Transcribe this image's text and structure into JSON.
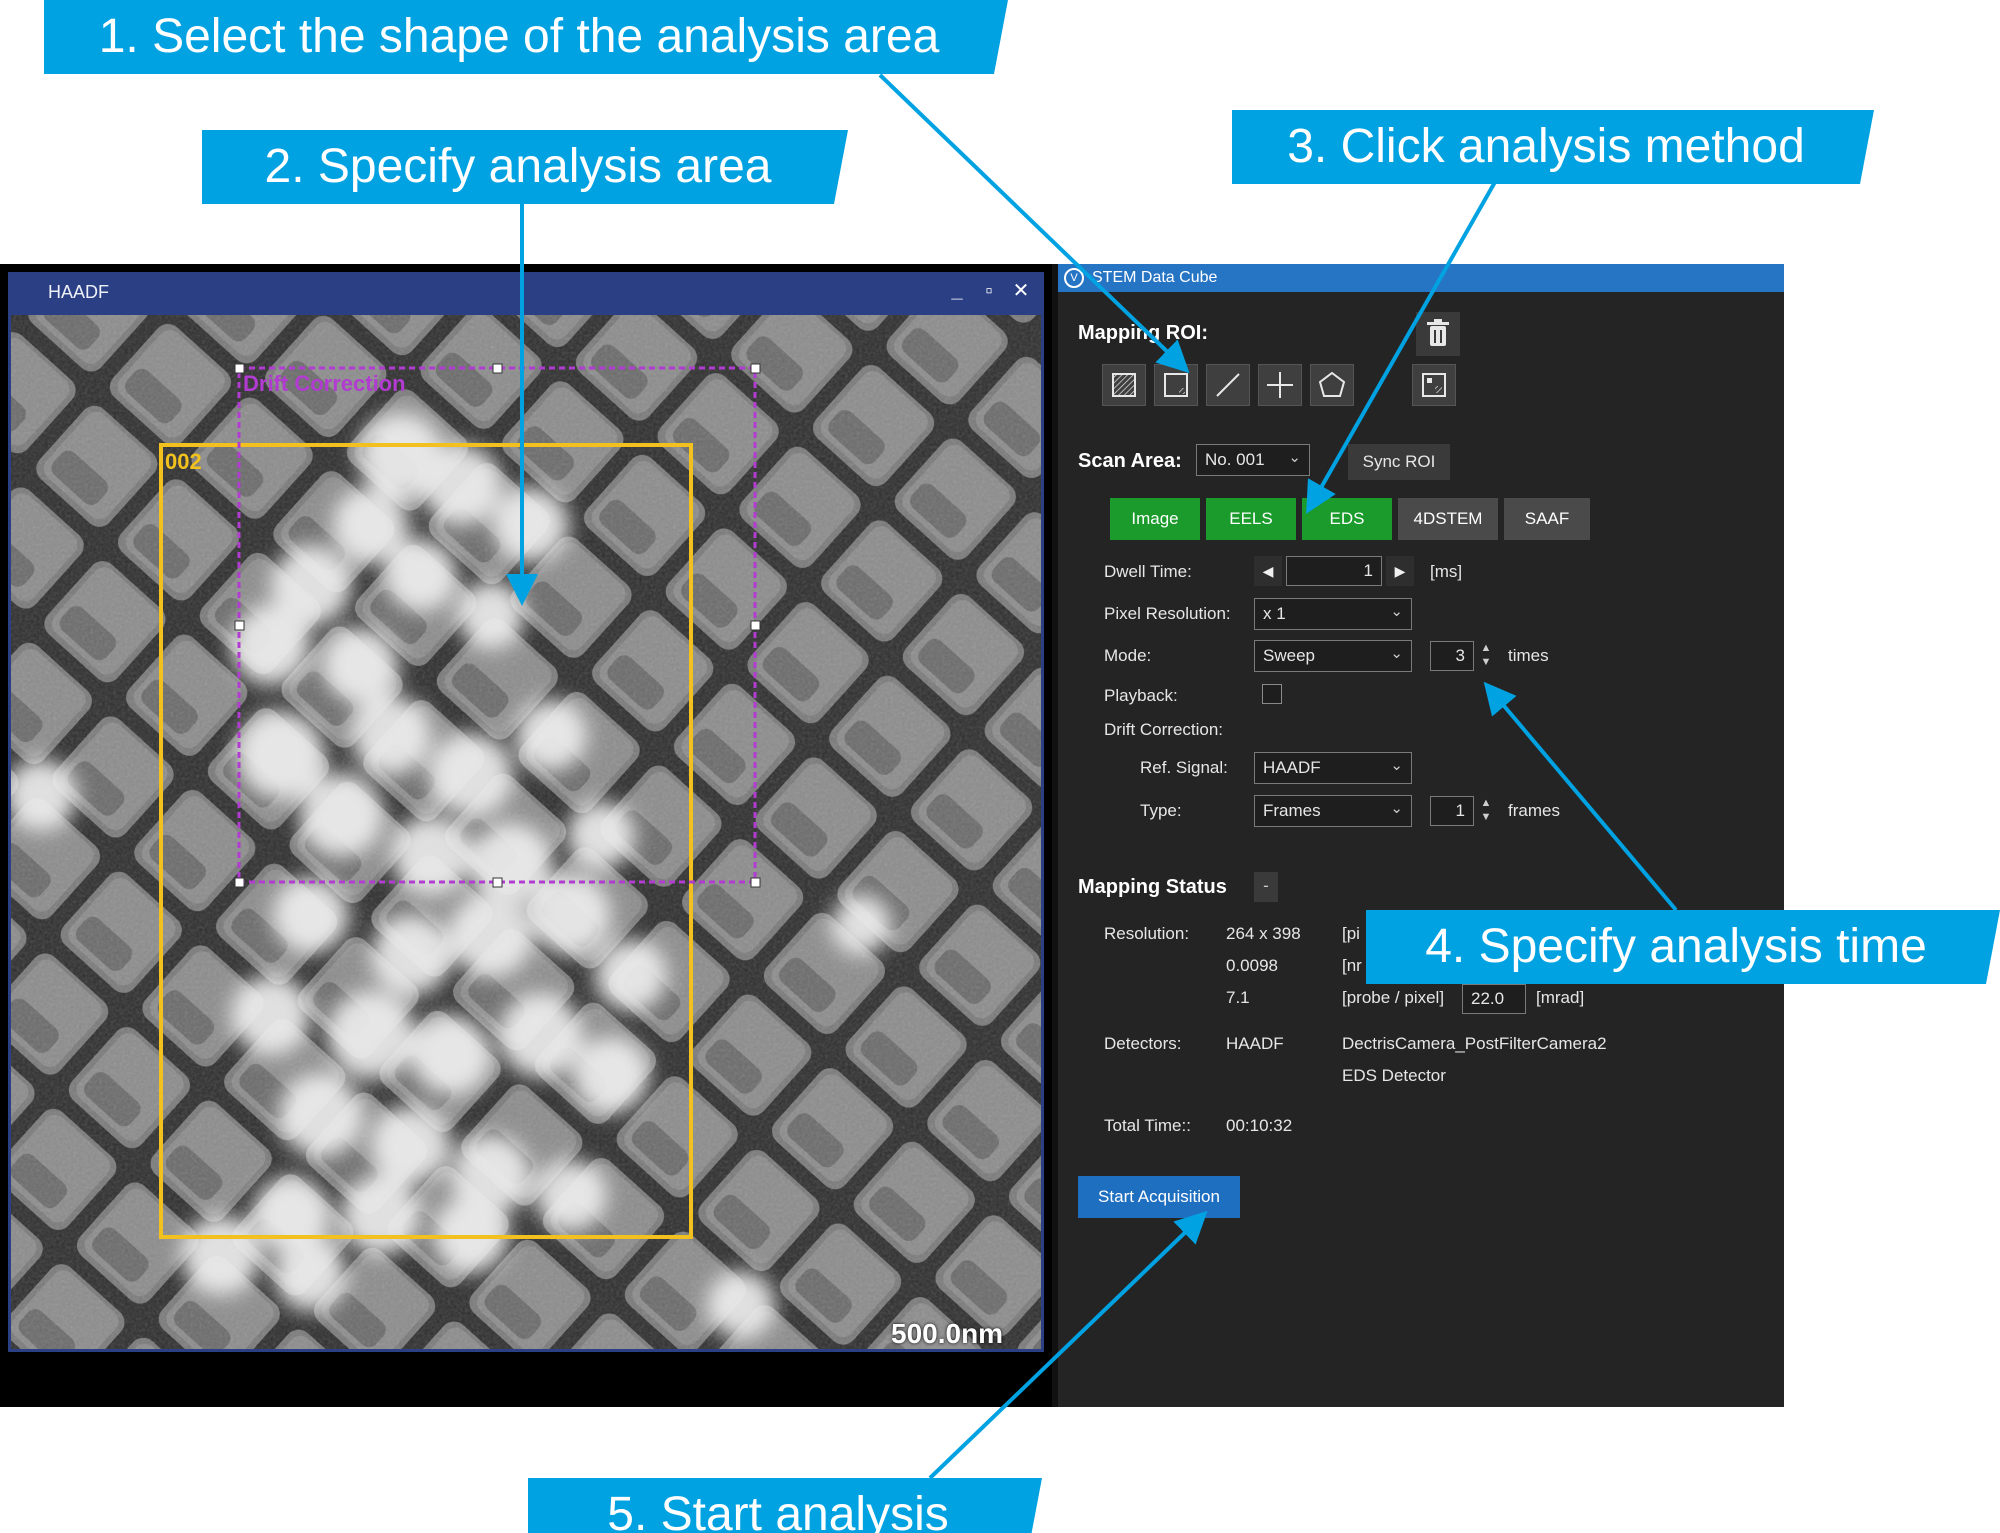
{
  "haadf_window": {
    "title": "HAADF",
    "minimize_glyph": "_",
    "maximize_glyph": "▫",
    "close_glyph": "✕",
    "roi_drift_label": "Drift Correction",
    "roi_002_label": "002",
    "roi_drift_color": "#b23bd1",
    "roi_002_color": "#f2c11d",
    "scale_bar_label": "500.0nm"
  },
  "stem_panel": {
    "title": "STEM Data Cube",
    "logo_glyph": "V",
    "mapping_roi_label": "Mapping ROI:",
    "roi_tools": [
      "hatched-rect-tool-icon",
      "rectangle-tool-icon",
      "line-tool-icon",
      "crosshair-tool-icon",
      "polygon-tool-icon",
      "image-roi-tool-icon"
    ],
    "scan_area_label": "Scan Area:",
    "scan_area_value": "No. 001",
    "sync_roi_label": "Sync ROI",
    "methods": [
      {
        "label": "Image",
        "active": true
      },
      {
        "label": "EELS",
        "active": true
      },
      {
        "label": "EDS",
        "active": true
      },
      {
        "label": "4DSTEM",
        "active": false
      },
      {
        "label": "SAAF",
        "active": false
      }
    ],
    "dwell_time_label": "Dwell Time:",
    "dwell_time_value": "1",
    "dwell_time_unit": "[ms]",
    "pixel_resolution_label": "Pixel Resolution:",
    "pixel_resolution_value": "x 1",
    "mode_label": "Mode:",
    "mode_value": "Sweep",
    "mode_times_value": "3",
    "mode_times_unit": "times",
    "playback_label": "Playback:",
    "drift_correction_label": "Drift Correction:",
    "ref_signal_label": "Ref. Signal:",
    "ref_signal_value": "HAADF",
    "type_label": "Type:",
    "type_value": "Frames",
    "type_frames_value": "1",
    "type_frames_unit": "frames",
    "mapping_status_label": "Mapping Status",
    "collapse_glyph": "-",
    "resolution_label": "Resolution:",
    "resolution_value": "264 x 398",
    "resolution_unit": "[pi",
    "pixel_size_value": "0.0098",
    "pixel_size_unit": "[nr",
    "probe_value": "7.1",
    "probe_unit": "[probe / pixel]",
    "mrad_value": "22.0",
    "mrad_unit": "[mrad]",
    "detectors_label": "Detectors:",
    "detector_1": "HAADF",
    "detector_2": "DectrisCamera_PostFilterCamera2",
    "detector_3": "EDS Detector",
    "total_time_label": "Total Time::",
    "total_time_value": "00:10:32",
    "start_button_label": "Start Acquisition",
    "method_active_color": "#1a9b2b",
    "accent_color": "#1f6fc1"
  },
  "annotations": {
    "step1": "1. Select the shape of the analysis area",
    "step2": "2. Specify analysis area",
    "step3": "3. Click analysis method",
    "step4": "4. Specify analysis time",
    "step5": "5. Start analysis",
    "callout_color": "#00a2e2"
  }
}
